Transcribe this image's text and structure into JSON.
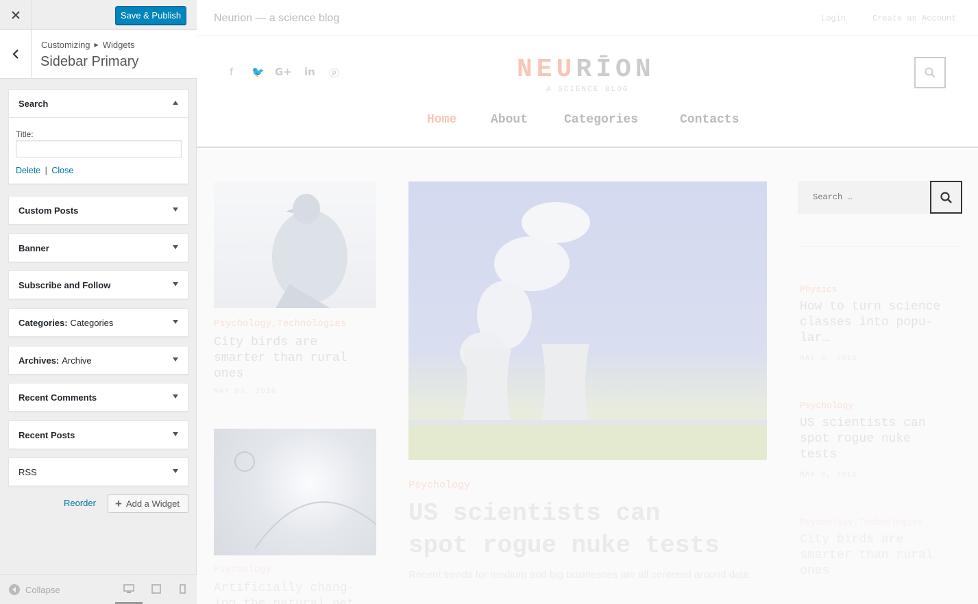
{
  "panel": {
    "publish_label": "Save & Publish",
    "breadcrumb": {
      "root": "Customizing",
      "current": "Widgets"
    },
    "section_title": "Sidebar Primary",
    "widgets": [
      {
        "title": "Search",
        "subtitle": "",
        "expanded": true,
        "field_label": "Title:",
        "field_value": "",
        "delete_label": "Delete",
        "separator": "|",
        "close_label": "Close"
      },
      {
        "title": "Custom Posts",
        "subtitle": ""
      },
      {
        "title": "Banner",
        "subtitle": ""
      },
      {
        "title": "Subscribe and Follow",
        "subtitle": ""
      },
      {
        "title": "Categories:",
        "subtitle": "Categories"
      },
      {
        "title": "Archives:",
        "subtitle": "Archive"
      },
      {
        "title": "Recent Comments",
        "subtitle": ""
      },
      {
        "title": "Recent Posts",
        "subtitle": ""
      },
      {
        "title": "RSS",
        "subtitle": ""
      }
    ],
    "reorder_label": "Reorder",
    "add_widget_label": "Add a Widget",
    "collapse_label": "Collapse"
  },
  "preview": {
    "tagline": "Neurion — a science blog",
    "login": "Login",
    "create_account": "Create an Account",
    "logo": {
      "part1": "NEU",
      "part2": "RĪON"
    },
    "logo_tagline": "A SCIENCE BLOG",
    "nav": [
      "Home",
      "About",
      "Categories",
      "Contacts"
    ],
    "posts_left": [
      {
        "category": "Psychology,Technologies",
        "title_lines": [
          "City birds are",
          "smarter than rural",
          "ones"
        ],
        "date": "MAY 03, 2016"
      },
      {
        "category": "Psychology",
        "title_lines": [
          "Artificially chang-",
          "ing the natural net"
        ]
      }
    ],
    "featured": {
      "category": "Psychology",
      "title_lines": [
        "US scientists can",
        "spot rogue nuke tests"
      ],
      "excerpt": "Recent trends for medium and big businesses are all centered around data"
    },
    "sidebar_search_placeholder": "Search …",
    "sidebar_posts": [
      {
        "category": "Physics",
        "title_lines": [
          "How to turn science",
          "classes into popu-",
          "lar…"
        ],
        "date": "MAY 8, 2016"
      },
      {
        "category": "Psychology",
        "title_lines": [
          "US scientists can",
          "spot rogue nuke",
          "tests"
        ],
        "date": "MAY 3, 2016"
      },
      {
        "category": "Psychology,Technologies",
        "title_lines": [
          "City birds are",
          "smarter than rural",
          "ones"
        ]
      }
    ]
  },
  "colors": {
    "primary": "#0085ba",
    "link": "#0073aa",
    "accent_faded": "#f6c7b6"
  }
}
